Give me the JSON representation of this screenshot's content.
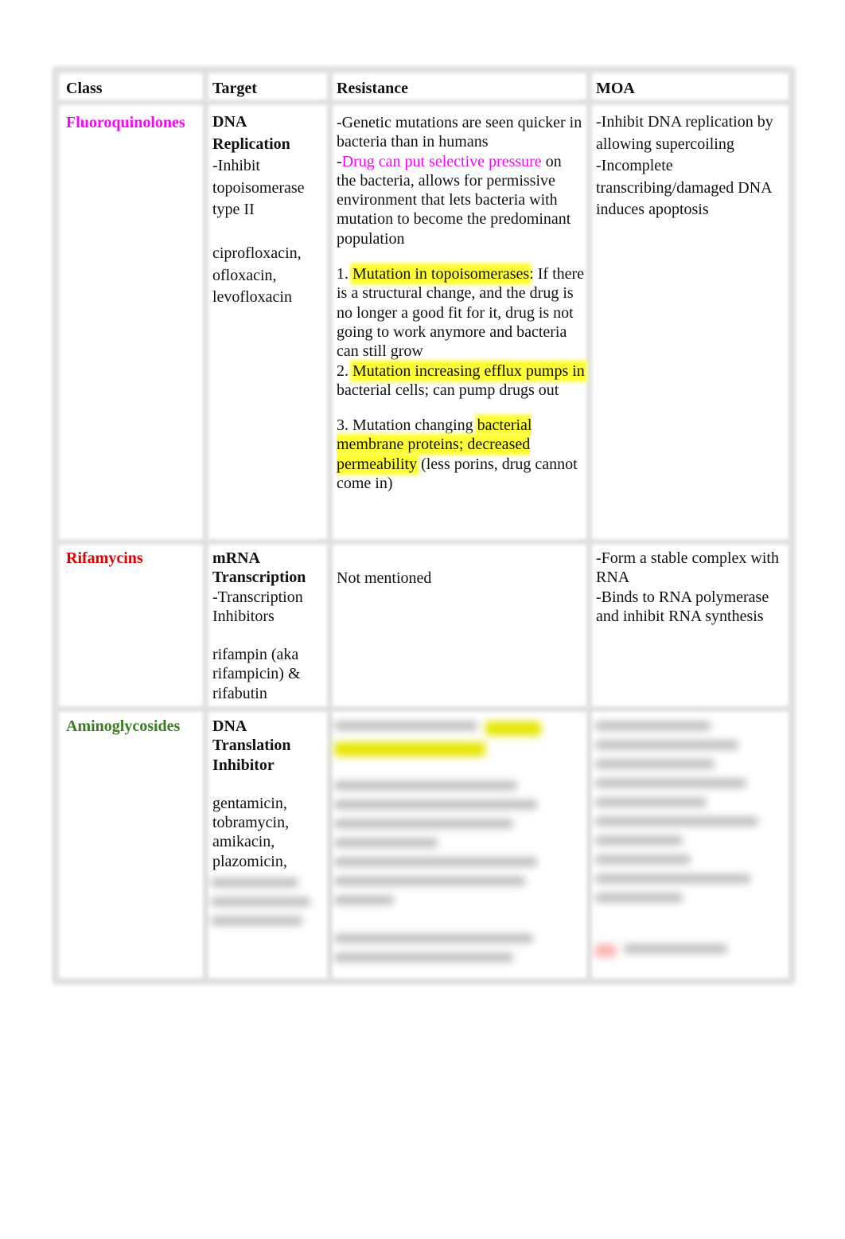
{
  "headers": [
    "Class",
    "Target",
    "Resistance",
    "MOA"
  ],
  "rows": [
    {
      "class": "Fluoroquinolones",
      "class_color": "#ff00ff",
      "target": {
        "title1": "DNA",
        "title2": "Replication",
        "lines": [
          "-Inhibit",
          "topoisomerase",
          "type II"
        ],
        "drugs": [
          "ciprofloxacin,",
          "ofloxacin,",
          "levofloxacin"
        ]
      },
      "resistance": {
        "p1": "-Genetic mutations are seen quicker in bacteria than in humans",
        "p2_dash": "-",
        "p2_pink": "Drug can put selective pressure",
        "p2_rest": " on the bacteria, allows for permissive environment that lets bacteria with mutation to become the predominant population",
        "i1_num": "1. ",
        "i1_hl": "Mutation in topoisomerases",
        "i1_rest": ": If there is a structural change, and the drug is no longer a good fit for it, drug is not going to work anymore and bacteria can still grow",
        "i2_num": "2. ",
        "i2_hl": "Mutation increasing efflux pumps in",
        "i2_rest": " bacterial cells; can pump drugs out",
        "i3_pre": "3. Mutation changing ",
        "i3_hl": "bacterial membrane proteins; decreased permeability",
        "i3_rest": " (less porins, drug cannot come in)"
      },
      "moa": [
        "-Inhibit DNA replication by allowing supercoiling",
        "-Incomplete transcribing/damaged DNA induces apoptosis"
      ]
    },
    {
      "class": "Rifamycins",
      "class_color": "#e00000",
      "target": {
        "title1": "mRNA",
        "title2": "Transcription",
        "lines": [
          "-Transcription",
          "Inhibitors"
        ],
        "drugs": [
          "rifampin (aka",
          "rifampicin) &",
          "rifabutin"
        ]
      },
      "resistance": "Not mentioned",
      "moa": [
        "-Form a stable complex with RNA",
        "-Binds to RNA polymerase and inhibit RNA synthesis"
      ]
    },
    {
      "class": "Aminoglycosides",
      "class_color": "#3a7d1e",
      "target": {
        "title1": "DNA",
        "title2": "Translation",
        "title3": "Inhibitor",
        "drugs": [
          "gentamicin,",
          "tobramycin,",
          "amikacin,",
          "plazomicin,"
        ]
      }
    }
  ]
}
